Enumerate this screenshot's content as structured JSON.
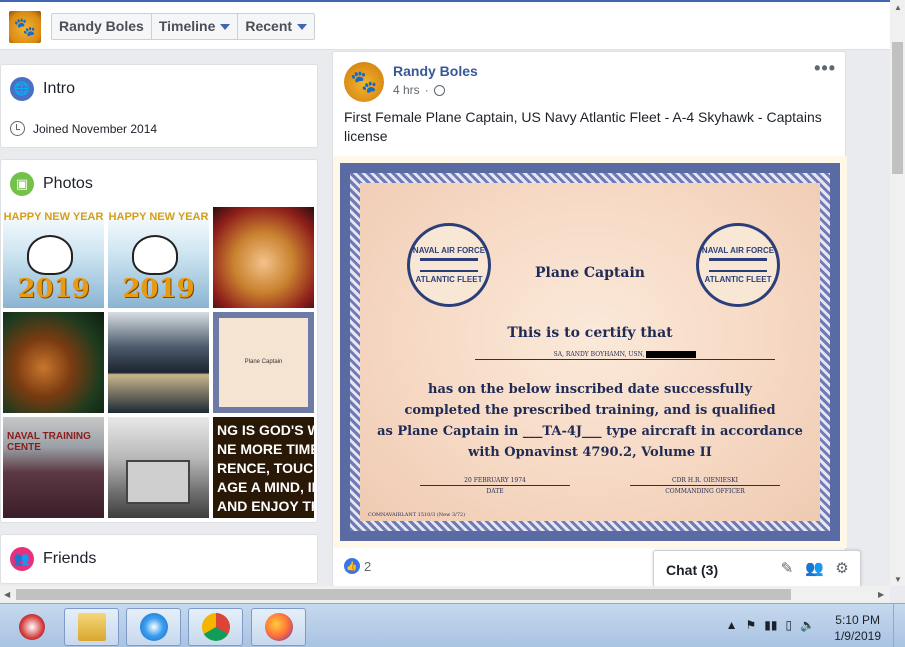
{
  "header": {
    "tabs": [
      {
        "label": "Randy Boles",
        "caret": false
      },
      {
        "label": "Timeline",
        "caret": true
      },
      {
        "label": "Recent",
        "caret": true
      }
    ]
  },
  "intro": {
    "title": "Intro",
    "joined": "Joined November 2014"
  },
  "photos": {
    "title": "Photos",
    "tiles": [
      {
        "name": "happy-new-year-snoopy-1",
        "top_text": "HAPPY NEW YEAR",
        "year": "2019"
      },
      {
        "name": "happy-new-year-snoopy-2",
        "top_text": "HAPPY NEW YEAR",
        "year": "2019"
      },
      {
        "name": "pomeranian-santa"
      },
      {
        "name": "pomeranian-christmas-lights"
      },
      {
        "name": "seagull-sunset"
      },
      {
        "name": "certificate-thumbnail"
      },
      {
        "name": "naval-training-center",
        "label": "NAVAL TRAINING CENTE"
      },
      {
        "name": "old-church"
      },
      {
        "name": "quote-image",
        "lines": [
          "NG IS GOD'S W",
          "NE MORE TIME,",
          "RENCE, TOUCH",
          "AGE A MIND, IN",
          "AND ENJOY TH"
        ]
      }
    ]
  },
  "friends": {
    "title": "Friends"
  },
  "post": {
    "author": "Randy Boles",
    "time": "4 hrs",
    "caption": "First Female Plane Captain, US Navy Atlantic Fleet - A-4 Skyhawk - Captains license",
    "like_count": "2",
    "certificate": {
      "seal_top": "NAVAL AIR FORCE",
      "seal_bottom": "ATLANTIC FLEET",
      "title": "Plane Captain",
      "certify": "This is to certify that",
      "name_line": "SA, RANDY BOYHAMN, USN,",
      "body_lines": [
        "has on the below inscribed date successfully",
        "completed the prescribed training, and is qualified",
        "as Plane Captain in ___TA-4J___ type aircraft in accordance",
        "with Opnavinst 4790.2, Volume II"
      ],
      "date_value": "20 FEBRUARY 1974",
      "date_label": "DATE",
      "co_value": "CDR H.R. OIENIESKI",
      "co_label": "COMMANDING OFFICER",
      "form_no": "COMNAVAIRLANT 1510/3 (New 3/72)"
    }
  },
  "chat": {
    "label": "Chat (3)"
  },
  "taskbar": {
    "time": "5:10 PM",
    "date": "1/9/2019"
  },
  "colors": {
    "facebook_blue": "#4267b2",
    "link_blue": "#385898",
    "page_bg": "#e9ebee"
  }
}
